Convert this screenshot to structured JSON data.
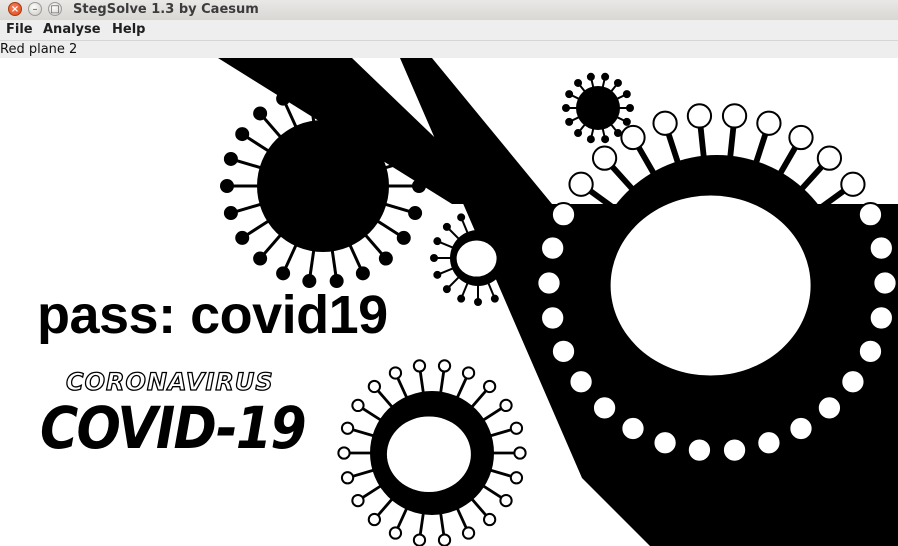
{
  "window": {
    "title": "StegSolve 1.3 by Caesum",
    "controls": {
      "close": "×",
      "minimize": "–",
      "maximize": "□"
    }
  },
  "menu": {
    "file": "File",
    "analyse": "Analyse",
    "help": "Help"
  },
  "view": {
    "plane_label": "Red plane 2"
  },
  "image_text": {
    "password": "pass: covid19",
    "coronavirus": "CORONAVIRUS",
    "covid": "COVID-19"
  }
}
